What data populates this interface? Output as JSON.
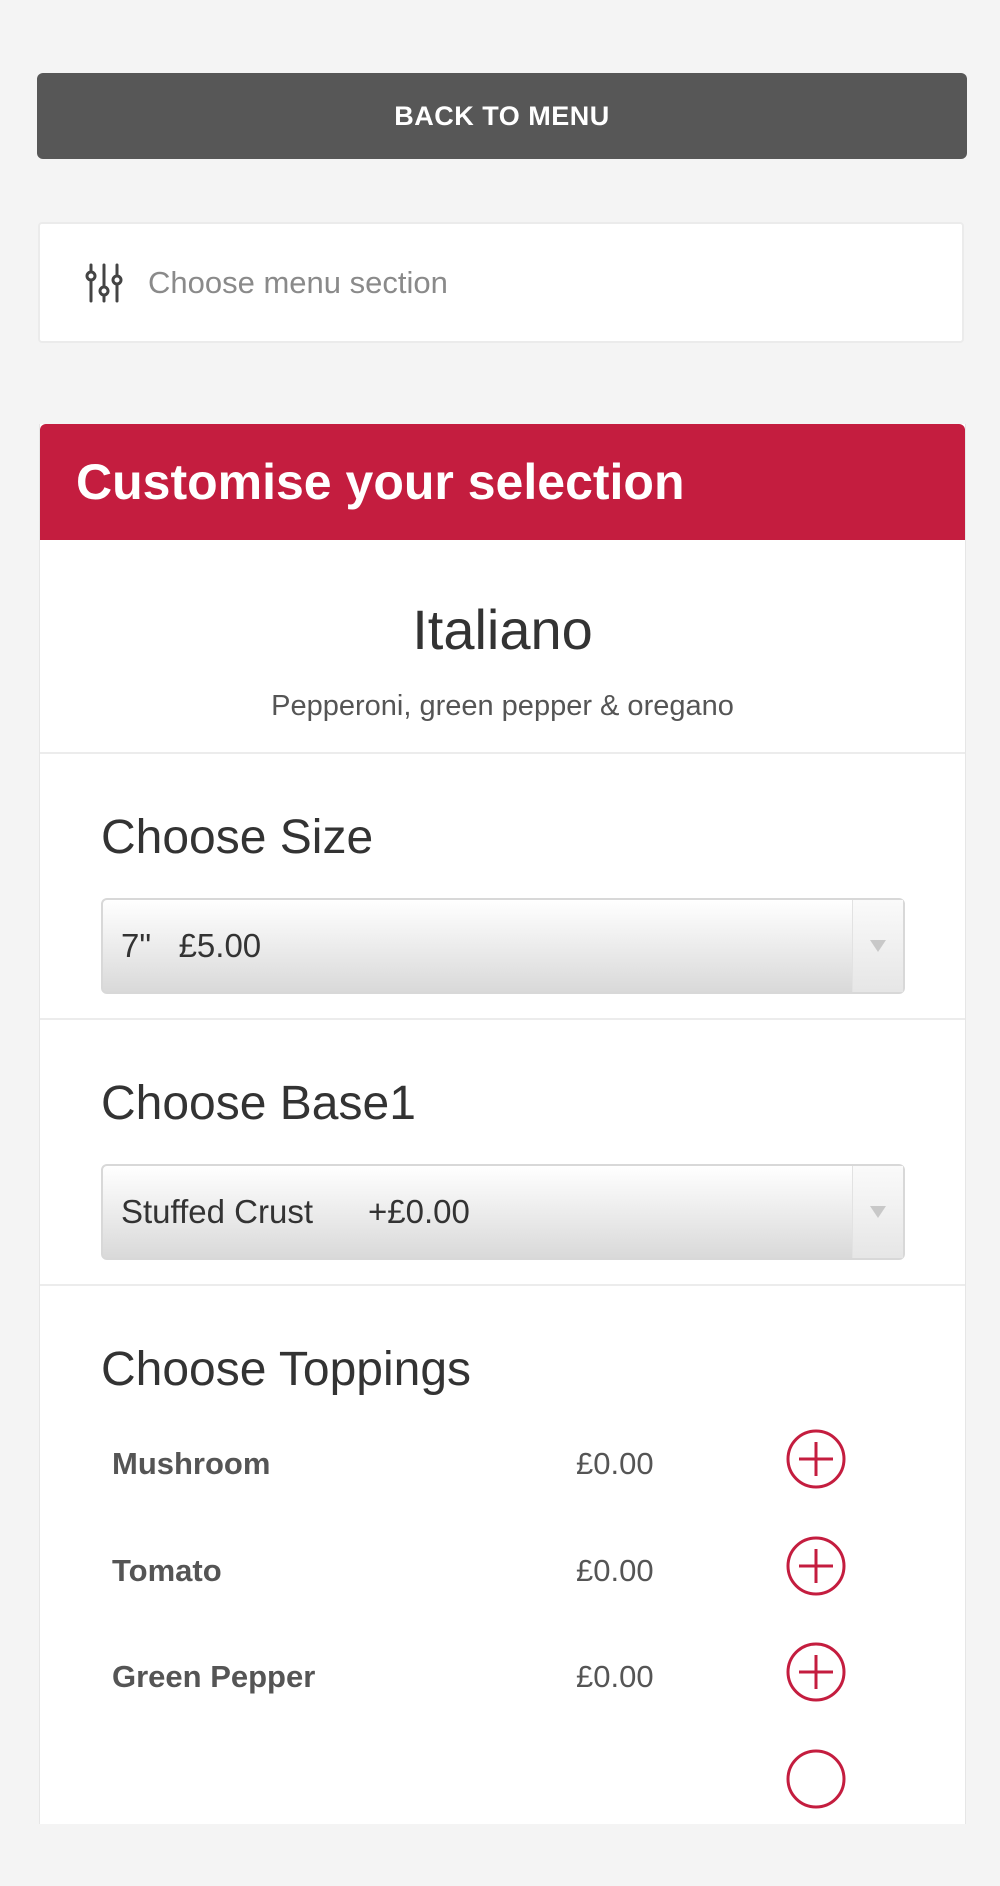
{
  "nav": {
    "back_label": "BACK TO MENU",
    "section_picker": "Choose menu section"
  },
  "header": {
    "title": "Customise your selection"
  },
  "product": {
    "name": "Italiano",
    "description": "Pepperoni, green pepper & oregano"
  },
  "size": {
    "title": "Choose Size",
    "selected": "7\"   £5.00"
  },
  "base": {
    "title": "Choose Base1",
    "selected": "Stuffed Crust      +£0.00"
  },
  "toppings": {
    "title": "Choose Toppings",
    "items": [
      {
        "name": "Mushroom",
        "price": "£0.00"
      },
      {
        "name": "Tomato",
        "price": "£0.00"
      },
      {
        "name": "Green Pepper",
        "price": "£0.00"
      }
    ]
  },
  "colors": {
    "accent": "#c41d3f",
    "button_dark": "#575757",
    "background": "#f4f4f4"
  },
  "icons": {
    "section_picker": "sliders-icon",
    "add_topping": "plus-circle-icon",
    "dropdown": "chevron-down-icon"
  }
}
